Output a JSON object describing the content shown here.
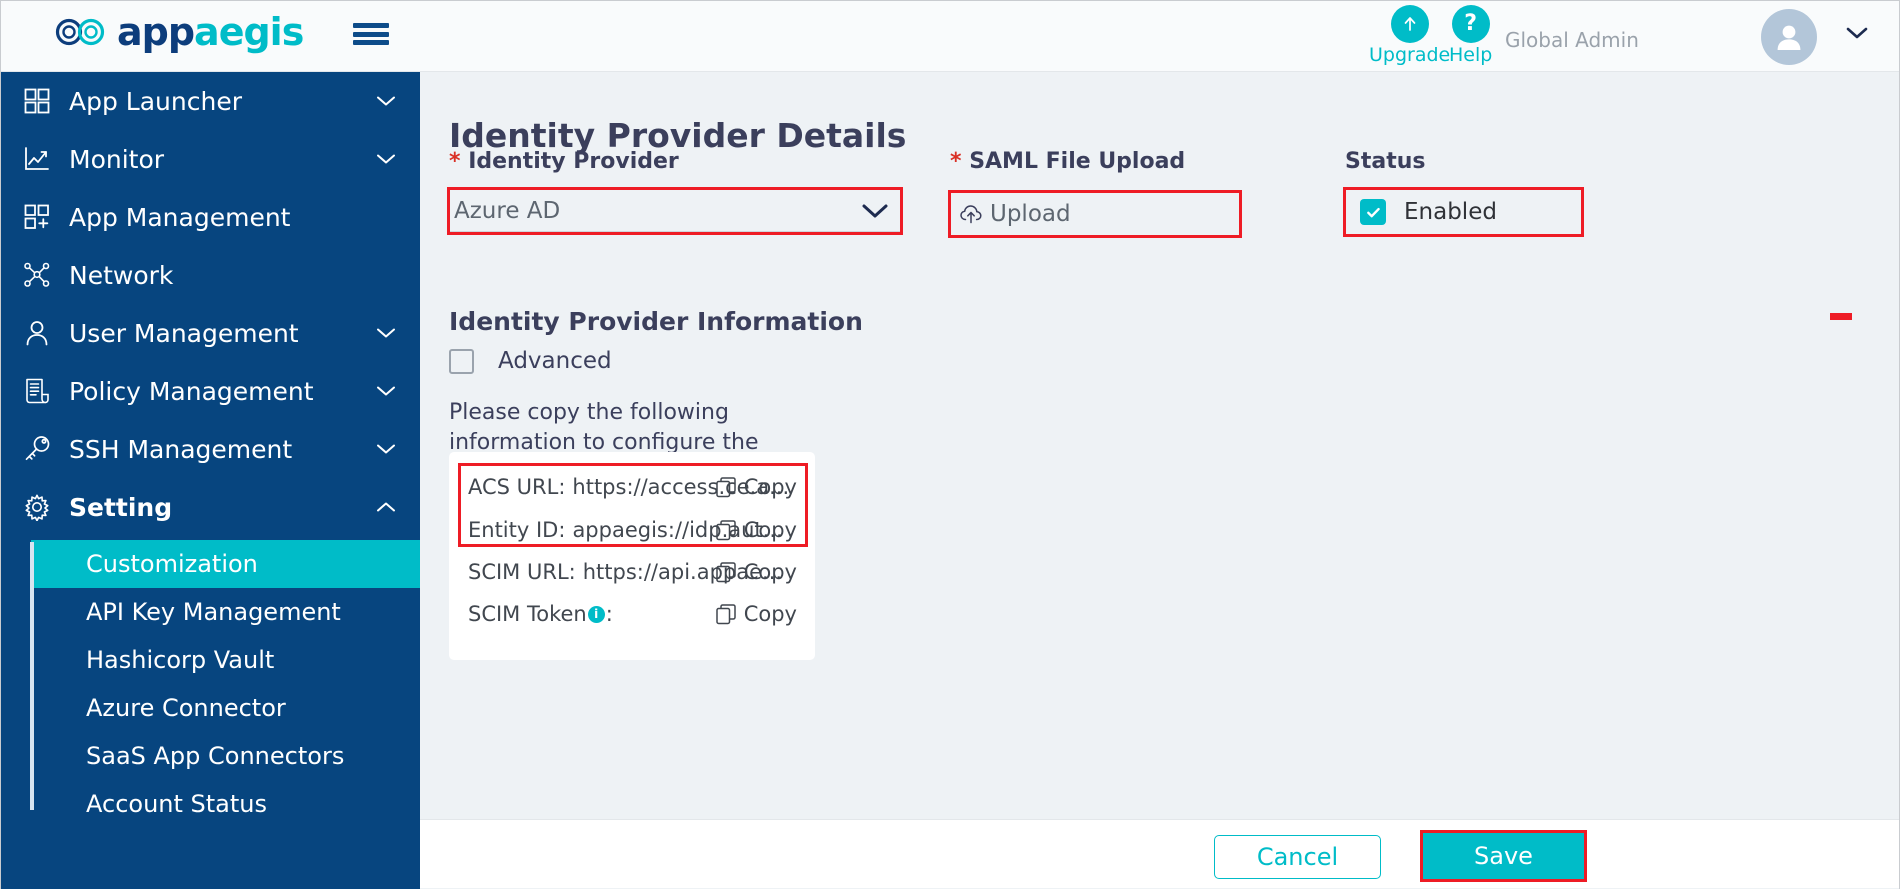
{
  "header": {
    "logo_text_part1": "app",
    "logo_text_part2": "aegis",
    "hamburger_icon": "hamburger-menu-icon",
    "upgrade_label": "Upgrade",
    "upgrade_icon": "arrow-up-icon",
    "help_label": "Help",
    "help_icon": "question-mark-icon",
    "role_label": "Global Admin",
    "avatar_icon": "user-avatar-icon",
    "caret_icon": "chevron-down-icon"
  },
  "sidebar": {
    "items": [
      {
        "label": "App Launcher",
        "icon": "grid-icon",
        "expandable": true,
        "expanded": false,
        "bold": false
      },
      {
        "label": "Monitor",
        "icon": "chart-line-icon",
        "expandable": true,
        "expanded": false,
        "bold": false
      },
      {
        "label": "App Management",
        "icon": "grid-plus-icon",
        "expandable": false,
        "expanded": false,
        "bold": false
      },
      {
        "label": "Network",
        "icon": "network-nodes-icon",
        "expandable": false,
        "expanded": false,
        "bold": false
      },
      {
        "label": "User Management",
        "icon": "user-icon",
        "expandable": true,
        "expanded": false,
        "bold": false
      },
      {
        "label": "Policy Management",
        "icon": "document-icon",
        "expandable": true,
        "expanded": false,
        "bold": false
      },
      {
        "label": "SSH Management",
        "icon": "key-icon",
        "expandable": true,
        "expanded": false,
        "bold": false
      },
      {
        "label": "Setting",
        "icon": "gear-icon",
        "expandable": true,
        "expanded": true,
        "bold": true
      }
    ],
    "sub_items": [
      {
        "label": "Customization",
        "active": true
      },
      {
        "label": "API Key Management",
        "active": false
      },
      {
        "label": "Hashicorp Vault",
        "active": false
      },
      {
        "label": "Azure Connector",
        "active": false
      },
      {
        "label": "SaaS App Connectors",
        "active": false
      },
      {
        "label": "Account Status",
        "active": false
      }
    ]
  },
  "main": {
    "page_title": "Identity Provider Details",
    "identity_provider": {
      "label": "Identity Provider",
      "required_marker": "*",
      "value": "Azure AD",
      "caret_icon": "chevron-down-icon"
    },
    "saml_file_upload": {
      "label": "SAML File Upload",
      "required_marker": "*",
      "button_label": "Upload",
      "icon": "cloud-upload-icon"
    },
    "status": {
      "label": "Status",
      "checkbox_label": "Enabled",
      "checked": true,
      "check_icon": "checkmark-icon"
    },
    "idp_information": {
      "title": "Identity Provider Information",
      "advanced_label": "Advanced",
      "advanced_checked": false,
      "hint_text": "Please copy the following information to configure the identity provider.",
      "rows": [
        {
          "key": "ACS URL:",
          "value": "https://access.ce.a...",
          "copy_label": "Copy",
          "copy_icon": "copy-icon",
          "has_info_badge": false
        },
        {
          "key": "Entity ID:",
          "value": "appaegis://idp.aut...",
          "copy_label": "Copy",
          "copy_icon": "copy-icon",
          "has_info_badge": false
        },
        {
          "key": "SCIM URL:",
          "value": "https://api.appae...",
          "copy_label": "Copy",
          "copy_icon": "copy-icon",
          "has_info_badge": false
        },
        {
          "key": "SCIM Token",
          "key_suffix": ":",
          "value": "",
          "copy_label": "Copy",
          "copy_icon": "copy-icon",
          "has_info_badge": true,
          "info_badge_icon": "info-icon"
        }
      ]
    }
  },
  "footer": {
    "cancel_label": "Cancel",
    "save_label": "Save"
  },
  "colors": {
    "brand_teal": "#00bcc8",
    "brand_navy": "#07457f",
    "highlight_red": "#ee1c25",
    "required_red": "#d93025",
    "page_bg": "#eef2f5",
    "text_dark": "#3b3f5c"
  }
}
